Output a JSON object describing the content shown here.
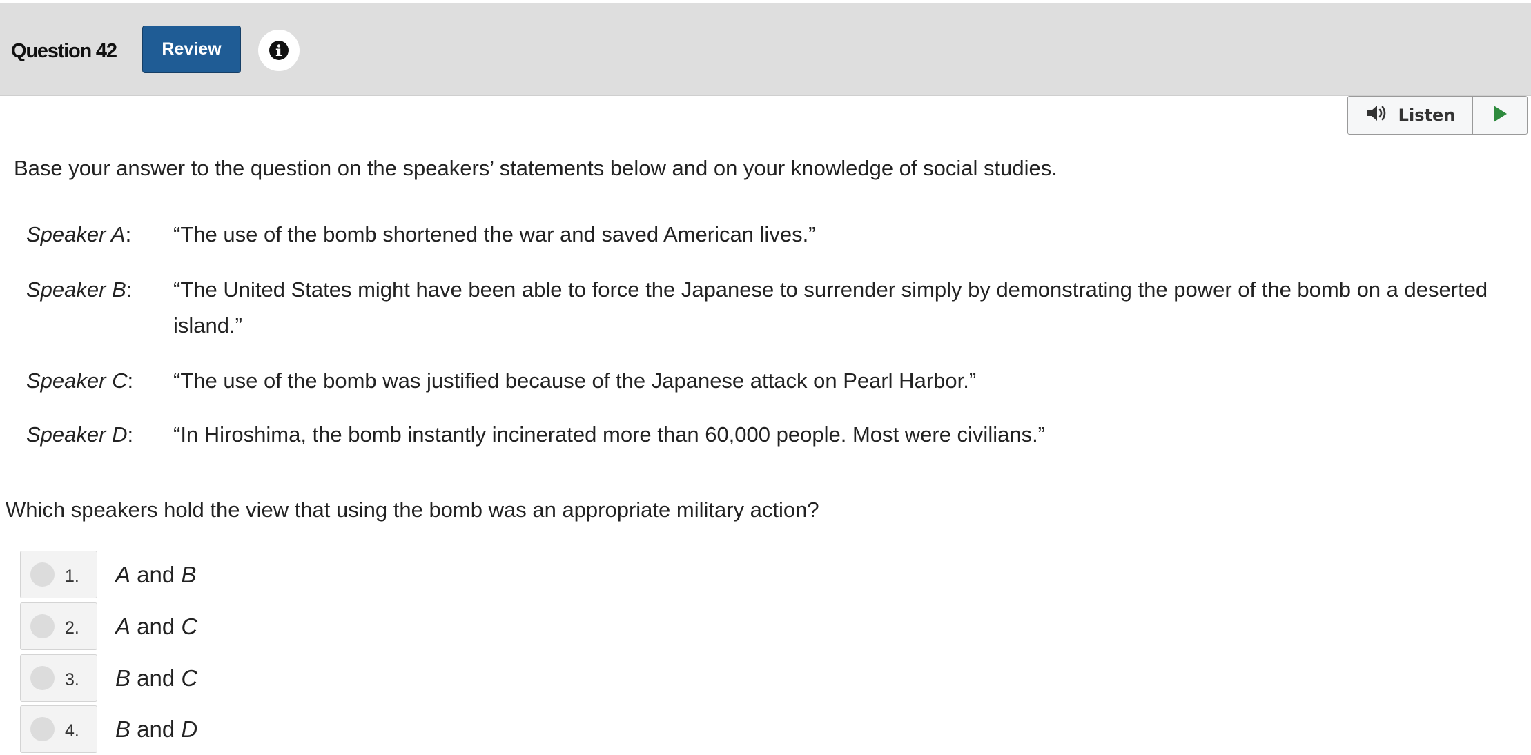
{
  "header": {
    "question_label": "Question 42",
    "review_label": "Review",
    "info_icon": "info-circle-icon"
  },
  "listen": {
    "label": "Listen",
    "speaker_icon": "volume-icon",
    "play_icon": "play-icon",
    "play_color": "#2e8b3e"
  },
  "passage": {
    "intro": "Base your answer to the question on the speakers’ statements below and on your knowledge of social studies.",
    "speakers": [
      {
        "name": "Speaker A",
        "quote": "“The use of the bomb shortened the war and saved American lives.”"
      },
      {
        "name": "Speaker B",
        "quote": "“The United States might have been able to force the Japanese to surrender simply by demonstrating the power of the bomb on a deserted island.”"
      },
      {
        "name": "Speaker C",
        "quote": "“The use of the bomb was justified because of the Japanese attack on Pearl Harbor.”"
      },
      {
        "name": "Speaker D",
        "quote": "“In Hiroshima, the bomb instantly incinerated more than 60,000 people. Most were civilians.”"
      }
    ]
  },
  "question": {
    "text": "Which speakers hold the view that using the bomb was an appropriate military action?",
    "choices": [
      {
        "number": "1.",
        "first": "A",
        "joiner": " and ",
        "second": "B"
      },
      {
        "number": "2.",
        "first": "A",
        "joiner": " and ",
        "second": "C"
      },
      {
        "number": "3.",
        "first": "B",
        "joiner": " and ",
        "second": "C"
      },
      {
        "number": "4.",
        "first": "B",
        "joiner": " and ",
        "second": "D"
      }
    ]
  },
  "colors": {
    "header_bg": "#dedede",
    "review_bg": "#1f5c95",
    "play_green": "#2e8b3e"
  }
}
